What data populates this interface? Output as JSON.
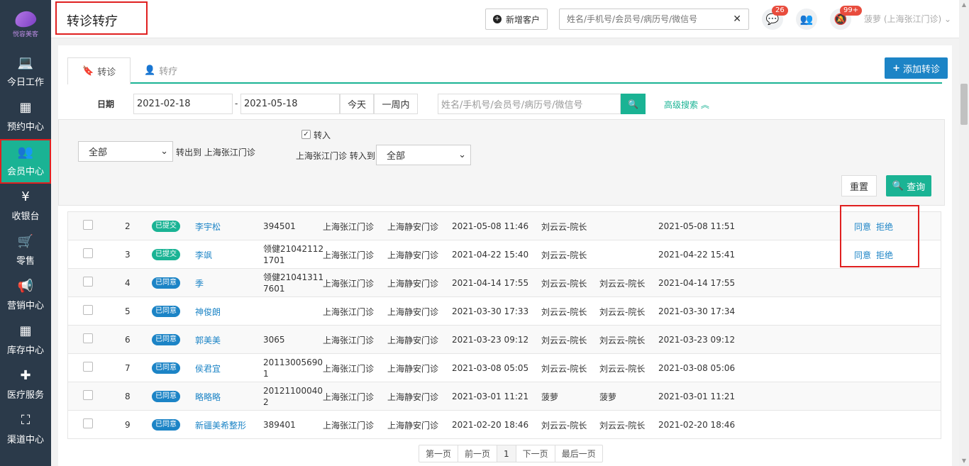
{
  "sidebar": {
    "logo_text": "悦容美客",
    "items": [
      {
        "label": "今日工作",
        "icon": "laptop-icon"
      },
      {
        "label": "预约中心",
        "icon": "calendar-icon"
      },
      {
        "label": "会员中心",
        "icon": "users-icon"
      },
      {
        "label": "收银台",
        "icon": "yen-icon"
      },
      {
        "label": "零售",
        "icon": "cart-icon"
      },
      {
        "label": "营销中心",
        "icon": "megaphone-icon"
      },
      {
        "label": "库存中心",
        "icon": "grid-icon"
      },
      {
        "label": "医疗服务",
        "icon": "medkit-icon"
      },
      {
        "label": "渠道中心",
        "icon": "sitemap-icon"
      }
    ]
  },
  "header": {
    "title": "转诊转疗",
    "new_customer_label": "新增客户",
    "search_placeholder": "姓名/手机号/会员号/病历号/微信号",
    "wechat_badge": "26",
    "notify_badge": "99+",
    "user": "菠萝 (上海张江门诊)"
  },
  "tabs": [
    {
      "label": "转诊",
      "icon": "bookmark-icon"
    },
    {
      "label": "转疗",
      "icon": "user-icon"
    }
  ],
  "add_button_label": "添加转诊",
  "filters": {
    "date_label": "日期",
    "date_from": "2021-02-18",
    "date_to": "2021-05-18",
    "date_sep": "-",
    "today_label": "今天",
    "week_label": "一周内",
    "search_placeholder": "姓名/手机号/会员号/病历号/微信号",
    "advanced_label": "高级搜索"
  },
  "advanced": {
    "out_select": "全部",
    "out_text": "转出到 上海张江门诊",
    "in_checkbox_label": "转入",
    "in_prefix": "上海张江门诊 转入到",
    "in_select": "全部",
    "reset_label": "重置",
    "query_label": "查询"
  },
  "rows": [
    {
      "no": "2",
      "status": "已提交",
      "status_type": "submit",
      "name": "李宇松",
      "code": "394501",
      "from": "上海张江门诊",
      "to": "上海静安门诊",
      "time1": "2021-05-08 11:46",
      "op1": "刘云云-院长",
      "op2": "",
      "time2": "2021-05-08 11:51",
      "agree": "同意",
      "reject": "拒绝"
    },
    {
      "no": "3",
      "status": "已提交",
      "status_type": "submit",
      "name": "李飒",
      "code": "领健210421121701",
      "from": "上海张江门诊",
      "to": "上海静安门诊",
      "time1": "2021-04-22 15:40",
      "op1": "刘云云-院长",
      "op2": "",
      "time2": "2021-04-22 15:41",
      "agree": "同意",
      "reject": "拒绝"
    },
    {
      "no": "4",
      "status": "已同意",
      "status_type": "agree",
      "name": "季",
      "code": "领健210413117601",
      "from": "上海张江门诊",
      "to": "上海静安门诊",
      "time1": "2021-04-14 17:55",
      "op1": "刘云云-院长",
      "op2": "刘云云-院长",
      "time2": "2021-04-14 17:55",
      "agree": "",
      "reject": ""
    },
    {
      "no": "5",
      "status": "已同意",
      "status_type": "agree",
      "name": "神俊朗",
      "code": "",
      "from": "上海张江门诊",
      "to": "上海静安门诊",
      "time1": "2021-03-30 17:33",
      "op1": "刘云云-院长",
      "op2": "刘云云-院长",
      "time2": "2021-03-30 17:34",
      "agree": "",
      "reject": ""
    },
    {
      "no": "6",
      "status": "已同意",
      "status_type": "agree",
      "name": "郭美美",
      "code": "3065",
      "from": "上海张江门诊",
      "to": "上海静安门诊",
      "time1": "2021-03-23 09:12",
      "op1": "刘云云-院长",
      "op2": "刘云云-院长",
      "time2": "2021-03-23 09:12",
      "agree": "",
      "reject": ""
    },
    {
      "no": "7",
      "status": "已同意",
      "status_type": "agree",
      "name": "侯君宜",
      "code": "201130056901",
      "from": "上海张江门诊",
      "to": "上海静安门诊",
      "time1": "2021-03-08 05:05",
      "op1": "刘云云-院长",
      "op2": "刘云云-院长",
      "time2": "2021-03-08 05:06",
      "agree": "",
      "reject": ""
    },
    {
      "no": "8",
      "status": "已同意",
      "status_type": "agree",
      "name": "略略略",
      "code": "201211000402",
      "from": "上海张江门诊",
      "to": "上海静安门诊",
      "time1": "2021-03-01 11:21",
      "op1": "菠萝",
      "op2": "菠萝",
      "time2": "2021-03-01 11:21",
      "agree": "",
      "reject": ""
    },
    {
      "no": "9",
      "status": "已同意",
      "status_type": "agree",
      "name": "新疆美希整形",
      "code": "389401",
      "from": "上海张江门诊",
      "to": "上海静安门诊",
      "time1": "2021-02-20 18:46",
      "op1": "刘云云-院长",
      "op2": "刘云云-院长",
      "time2": "2021-02-20 18:46",
      "agree": "",
      "reject": ""
    }
  ],
  "pager": {
    "first": "第一页",
    "prev": "前一页",
    "current": "1",
    "next": "下一页",
    "last": "最后一页"
  }
}
